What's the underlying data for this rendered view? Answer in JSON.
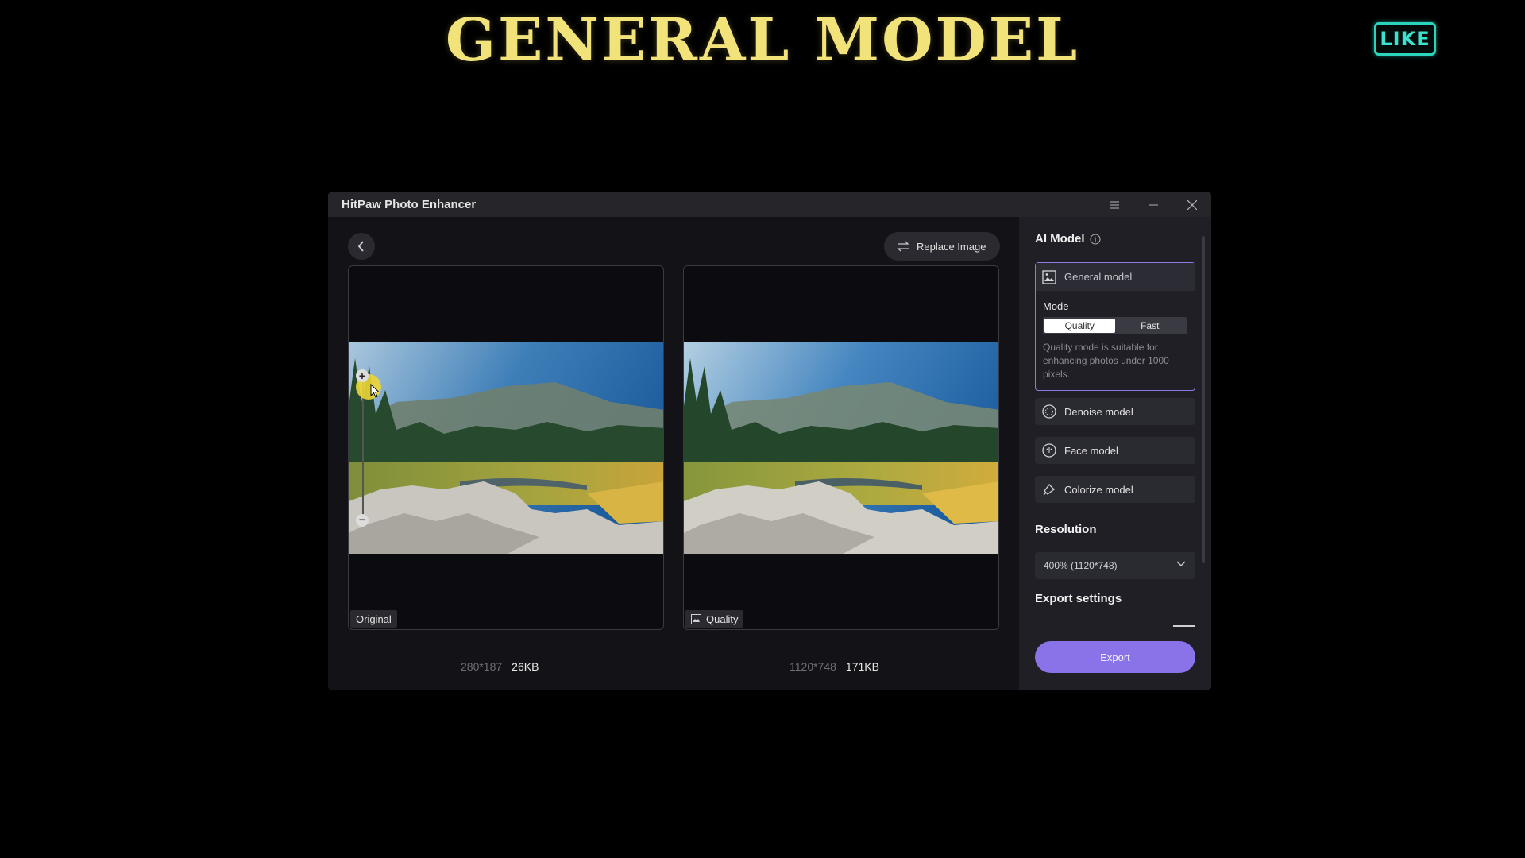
{
  "overlay": {
    "headline": "GENERAL MODEL",
    "like_badge": "LIKE"
  },
  "window": {
    "title": "HitPaw Photo Enhancer",
    "controls": [
      "menu-icon",
      "minimize-icon",
      "close-icon"
    ]
  },
  "toolbar": {
    "replace_label": "Replace Image"
  },
  "preview": {
    "original_tag": "Original",
    "enhanced_tag": "Quality",
    "original_dims": "280*187",
    "original_size": "26KB",
    "enhanced_dims": "1120*748",
    "enhanced_size": "171KB"
  },
  "sidebar": {
    "ai_model_title": "AI Model",
    "general_model": "General model",
    "mode_label": "Mode",
    "mode_options": [
      "Quality",
      "Fast"
    ],
    "mode_selected": "Quality",
    "mode_description": "Quality mode is suitable for enhancing photos under 1000 pixels.",
    "models": [
      "Denoise model",
      "Face model",
      "Colorize model"
    ],
    "resolution_title": "Resolution",
    "resolution_value": "400% (1120*748)",
    "export_settings_title": "Export settings",
    "export_label": "Export"
  },
  "colors": {
    "accent": "#8a73e8",
    "headline": "#f2e27a",
    "like": "#2bd4bd"
  }
}
